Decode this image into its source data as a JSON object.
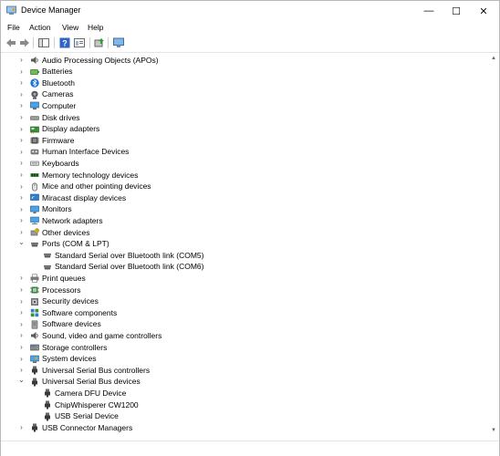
{
  "window": {
    "title": "Device Manager",
    "minimize_glyph": "—",
    "maximize_glyph": "☐",
    "close_glyph": "✕"
  },
  "menu": [
    "File",
    "Action",
    "View",
    "Help"
  ],
  "toolbar": [
    "back-icon",
    "forward-icon",
    "console-tree-icon",
    "help-icon",
    "properties-icon",
    "update-driver-icon",
    "scan-hardware-icon"
  ],
  "tree": [
    {
      "label": "Audio Processing Objects (APOs)",
      "level": 0,
      "expanded": false,
      "icon": "speaker-icon"
    },
    {
      "label": "Batteries",
      "level": 0,
      "expanded": false,
      "icon": "battery-icon"
    },
    {
      "label": "Bluetooth",
      "level": 0,
      "expanded": false,
      "icon": "bluetooth-icon"
    },
    {
      "label": "Cameras",
      "level": 0,
      "expanded": false,
      "icon": "camera-icon"
    },
    {
      "label": "Computer",
      "level": 0,
      "expanded": false,
      "icon": "computer-icon"
    },
    {
      "label": "Disk drives",
      "level": 0,
      "expanded": false,
      "icon": "disk-icon"
    },
    {
      "label": "Display adapters",
      "level": 0,
      "expanded": false,
      "icon": "display-adapter-icon"
    },
    {
      "label": "Firmware",
      "level": 0,
      "expanded": false,
      "icon": "firmware-icon"
    },
    {
      "label": "Human Interface Devices",
      "level": 0,
      "expanded": false,
      "icon": "hid-icon"
    },
    {
      "label": "Keyboards",
      "level": 0,
      "expanded": false,
      "icon": "keyboard-icon"
    },
    {
      "label": "Memory technology devices",
      "level": 0,
      "expanded": false,
      "icon": "memory-icon"
    },
    {
      "label": "Mice and other pointing devices",
      "level": 0,
      "expanded": false,
      "icon": "mouse-icon"
    },
    {
      "label": "Miracast display devices",
      "level": 0,
      "expanded": false,
      "icon": "miracast-icon"
    },
    {
      "label": "Monitors",
      "level": 0,
      "expanded": false,
      "icon": "monitor-icon"
    },
    {
      "label": "Network adapters",
      "level": 0,
      "expanded": false,
      "icon": "network-icon"
    },
    {
      "label": "Other devices",
      "level": 0,
      "expanded": false,
      "icon": "other-device-icon"
    },
    {
      "label": "Ports (COM & LPT)",
      "level": 0,
      "expanded": true,
      "icon": "port-icon"
    },
    {
      "label": "Standard Serial over Bluetooth link (COM5)",
      "level": 1,
      "expanded": null,
      "icon": "port-icon"
    },
    {
      "label": "Standard Serial over Bluetooth link (COM6)",
      "level": 1,
      "expanded": null,
      "icon": "port-icon"
    },
    {
      "label": "Print queues",
      "level": 0,
      "expanded": false,
      "icon": "printer-icon"
    },
    {
      "label": "Processors",
      "level": 0,
      "expanded": false,
      "icon": "processor-icon"
    },
    {
      "label": "Security devices",
      "level": 0,
      "expanded": false,
      "icon": "security-icon"
    },
    {
      "label": "Software components",
      "level": 0,
      "expanded": false,
      "icon": "software-component-icon"
    },
    {
      "label": "Software devices",
      "level": 0,
      "expanded": false,
      "icon": "software-device-icon"
    },
    {
      "label": "Sound, video and game controllers",
      "level": 0,
      "expanded": false,
      "icon": "speaker-icon"
    },
    {
      "label": "Storage controllers",
      "level": 0,
      "expanded": false,
      "icon": "storage-icon"
    },
    {
      "label": "System devices",
      "level": 0,
      "expanded": false,
      "icon": "system-icon"
    },
    {
      "label": "Universal Serial Bus controllers",
      "level": 0,
      "expanded": false,
      "icon": "usb-icon"
    },
    {
      "label": "Universal Serial Bus devices",
      "level": 0,
      "expanded": true,
      "icon": "usb-icon"
    },
    {
      "label": "Camera DFU Device",
      "level": 1,
      "expanded": null,
      "icon": "usb-icon"
    },
    {
      "label": "ChipWhisperer CW1200",
      "level": 1,
      "expanded": null,
      "icon": "usb-icon"
    },
    {
      "label": "USB Serial Device",
      "level": 1,
      "expanded": null,
      "icon": "usb-icon"
    },
    {
      "label": "USB Connector Managers",
      "level": 0,
      "expanded": false,
      "icon": "usb-icon"
    }
  ],
  "colors": {
    "accent": "#1e74d0",
    "folder": "#3a8ee6"
  }
}
